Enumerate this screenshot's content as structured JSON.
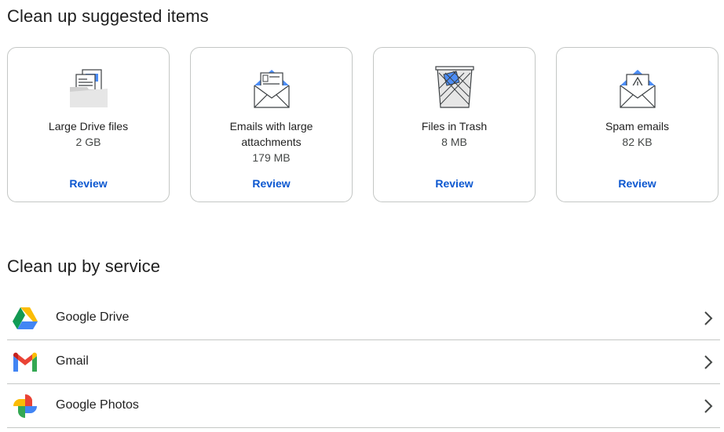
{
  "suggested": {
    "title": "Clean up suggested items",
    "cards": [
      {
        "title": "Large Drive files",
        "size": "2 GB",
        "action": "Review",
        "icon": "drive-files-illustration-icon"
      },
      {
        "title": "Emails with large attachments",
        "size": "179 MB",
        "action": "Review",
        "icon": "email-attachment-illustration-icon"
      },
      {
        "title": "Files in Trash",
        "size": "8 MB",
        "action": "Review",
        "icon": "trash-bin-illustration-icon"
      },
      {
        "title": "Spam emails",
        "size": "82 KB",
        "action": "Review",
        "icon": "spam-email-illustration-icon"
      }
    ]
  },
  "by_service": {
    "title": "Clean up by service",
    "items": [
      {
        "label": "Google Drive",
        "icon": "google-drive-logo-icon"
      },
      {
        "label": "Gmail",
        "icon": "gmail-logo-icon"
      },
      {
        "label": "Google Photos",
        "icon": "google-photos-logo-icon"
      }
    ]
  },
  "colors": {
    "accent": "#0b57d0",
    "border": "#c4c7c5",
    "text": "#1f1f1f",
    "secondary_text": "#444746"
  }
}
